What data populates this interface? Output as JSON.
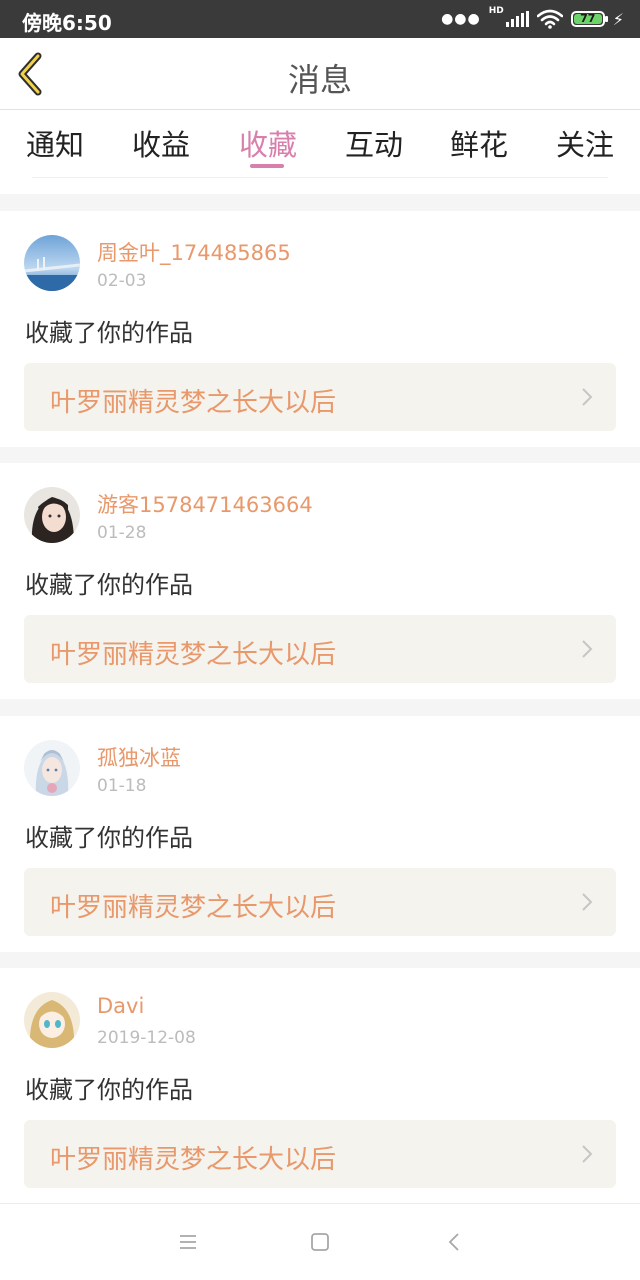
{
  "status_bar": {
    "time": "傍晚6:50",
    "network_label": "HD",
    "battery_level": "77",
    "icons": [
      "dots-icon",
      "signal-icon",
      "wifi-icon",
      "battery-icon",
      "charging-icon"
    ]
  },
  "header": {
    "title": "消息",
    "back_icon": "back-chevron-icon"
  },
  "tabs": [
    {
      "label": "通知",
      "active": false
    },
    {
      "label": "收益",
      "active": false
    },
    {
      "label": "收藏",
      "active": true
    },
    {
      "label": "互动",
      "active": false
    },
    {
      "label": "鲜花",
      "active": false
    },
    {
      "label": "关注",
      "active": false
    }
  ],
  "messages": [
    {
      "username": "周金叶_174485865",
      "date": "02-03",
      "action": "收藏了你的作品",
      "work_title": "叶罗丽精灵梦之长大以后"
    },
    {
      "username": "游客1578471463664",
      "date": "01-28",
      "action": "收藏了你的作品",
      "work_title": "叶罗丽精灵梦之长大以后"
    },
    {
      "username": "孤独冰蓝",
      "date": "01-18",
      "action": "收藏了你的作品",
      "work_title": "叶罗丽精灵梦之长大以后"
    },
    {
      "username": "Davi",
      "date": "2019-12-08",
      "action": "收藏了你的作品",
      "work_title": "叶罗丽精灵梦之长大以后"
    }
  ],
  "bottom_nav": {
    "icons": [
      "menu-icon",
      "home-icon",
      "back-icon"
    ]
  },
  "colors": {
    "accent": "#d97fac",
    "username": "#e8986a",
    "status_bar": "#3a3a3a",
    "link_bg": "#f4f3ee"
  }
}
